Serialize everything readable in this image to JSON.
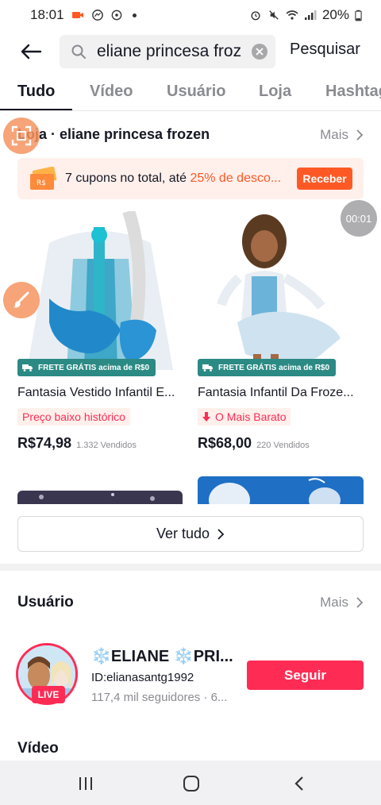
{
  "status_bar": {
    "time": "18:01",
    "battery": "20%"
  },
  "search": {
    "query": "eliane princesa frozen",
    "submit_label": "Pesquisar"
  },
  "tabs": [
    {
      "label": "Tudo",
      "active": true
    },
    {
      "label": "Vídeo",
      "active": false
    },
    {
      "label": "Usuário",
      "active": false
    },
    {
      "label": "Loja",
      "active": false
    },
    {
      "label": "Hashtags",
      "active": false
    }
  ],
  "shop": {
    "title": "Loja · eliane princesa frozen",
    "more_label": "Mais",
    "coupon": {
      "text_prefix": "7 cupons no total, até ",
      "text_highlight": "25% de desco...",
      "button_label": "Receber",
      "icon_text": "R$"
    },
    "products": [
      {
        "name": "Fantasia Vestido Infantil E...",
        "shipping_tag": "FRETE GRÁTIS acima de R$0",
        "badge": "Preço baixo histórico",
        "price": "R$74,98",
        "sold": "1.332 Vendidos"
      },
      {
        "name": "Fantasia Infantil Da Froze...",
        "shipping_tag": "FRETE GRÁTIS acima de R$0",
        "badge": "O Mais Barato",
        "price": "R$68,00",
        "sold": "220 Vendidos"
      }
    ],
    "see_all_label": "Ver tudo"
  },
  "user_section": {
    "title": "Usuário",
    "more_label": "Mais",
    "user": {
      "name": "❄️ELIANE ❄️PRI...",
      "id": "ID:elianasantg1992",
      "followers": "117,4 mil seguidores · 6...",
      "live_label": "LIVE",
      "follow_label": "Seguir"
    }
  },
  "video_section": {
    "title": "Vídeo"
  },
  "floating": {
    "timer": "00:01"
  },
  "colors": {
    "accent": "#fe5925",
    "follow": "#fe2c55",
    "shipping": "#2b8a84"
  }
}
